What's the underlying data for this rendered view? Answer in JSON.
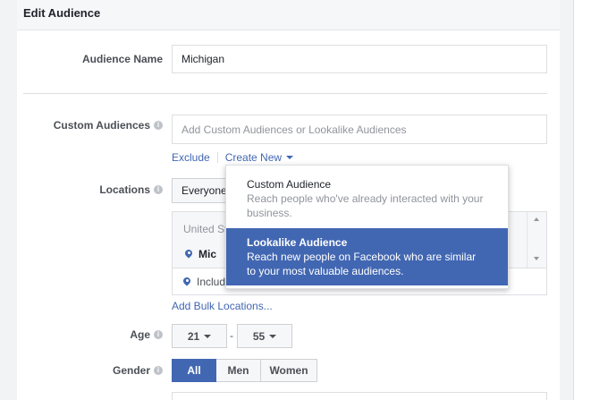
{
  "header": {
    "title": "Edit Audience"
  },
  "audience_name": {
    "label": "Audience Name",
    "value": "Michigan"
  },
  "custom_audiences": {
    "label": "Custom Audiences",
    "placeholder": "Add Custom Audiences or Lookalike Audiences",
    "exclude_label": "Exclude",
    "create_new_label": "Create New"
  },
  "dropdown": {
    "items": [
      {
        "title": "Custom Audience",
        "description_line1": "Reach people who've already interacted with your",
        "description_line2": "business."
      },
      {
        "title": "Lookalike Audience",
        "description_line1": "Reach new people on Facebook who are similar",
        "description_line2": "to your most valuable audiences."
      }
    ]
  },
  "locations": {
    "label": "Locations",
    "selector_value": "Everyone",
    "country_partial": "United St",
    "location_partial": "Mic",
    "include_partial": "Includ",
    "bulk_link": "Add Bulk Locations..."
  },
  "age": {
    "label": "Age",
    "min": "21",
    "separator": "-",
    "max": "55"
  },
  "gender": {
    "label": "Gender",
    "options": [
      "All",
      "Men",
      "Women"
    ],
    "selected": "All"
  },
  "colors": {
    "accent": "#4267b2",
    "panel_bg": "#ffffff",
    "page_bg": "#f2f3f5",
    "label": "#4b4f56"
  }
}
